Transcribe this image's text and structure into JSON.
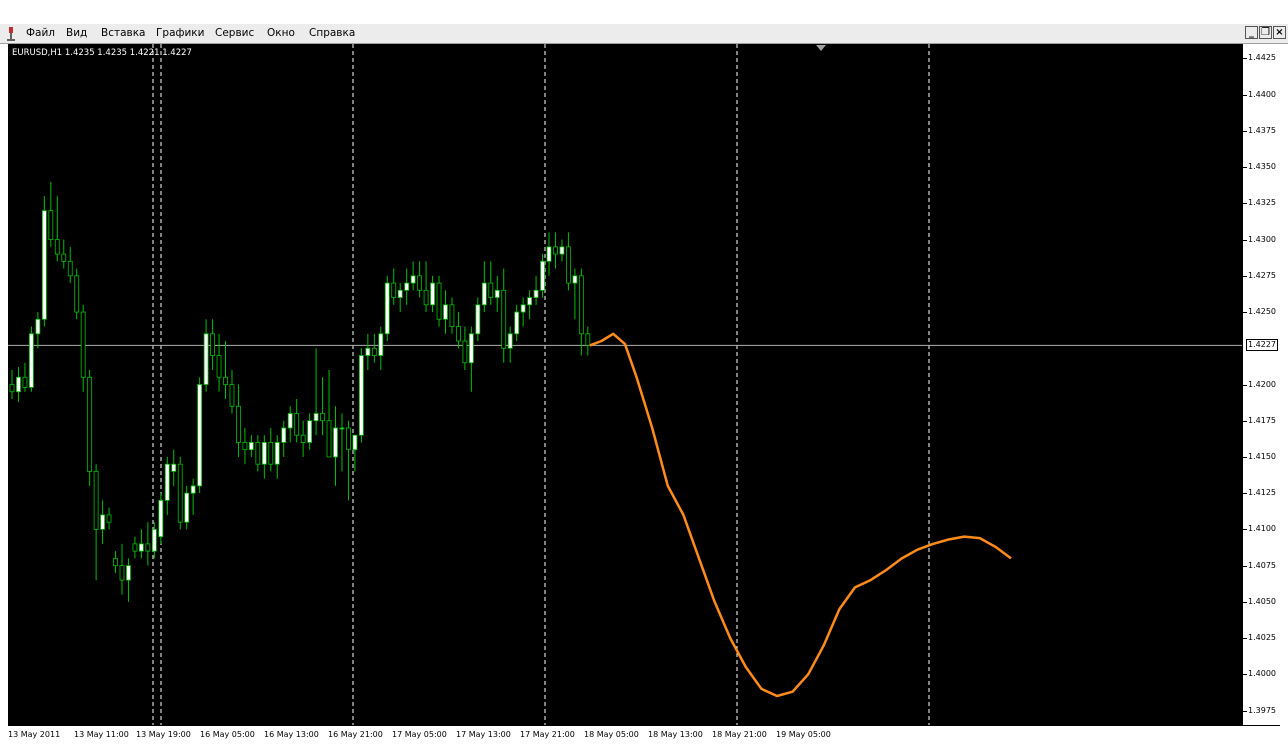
{
  "menu": {
    "items": [
      {
        "label": "Файл"
      },
      {
        "label": "Вид"
      },
      {
        "label": "Вставка"
      },
      {
        "label": "Графики"
      },
      {
        "label": "Сервис"
      },
      {
        "label": "Окно"
      },
      {
        "label": "Справка"
      }
    ]
  },
  "window_controls": {
    "minimize": "_",
    "restore": "❐",
    "close": "×"
  },
  "chart": {
    "symbol_info": "EURUSD,H1  1.4235 1.4235 1.4221 1.4227",
    "current_price": "1.4227",
    "colors": {
      "background": "#000000",
      "bull_candle": "#ffffff",
      "bear_candle": "#000000",
      "wick": "#00c000",
      "forecast_line": "#ff8c1a",
      "grid": "#ffffff"
    }
  },
  "chart_data": {
    "type": "candlestick",
    "symbol": "EURUSD",
    "timeframe": "H1",
    "ylim": [
      1.3965,
      1.4435
    ],
    "y_ticks": [
      "1.4425",
      "1.4400",
      "1.4375",
      "1.4350",
      "1.4325",
      "1.4300",
      "1.4275",
      "1.4250",
      "1.4200",
      "1.4175",
      "1.4150",
      "1.4125",
      "1.4100",
      "1.4075",
      "1.4050",
      "1.4025",
      "1.4000",
      "1.3975"
    ],
    "x_ticks": [
      "13 May 2011",
      "13 May 11:00",
      "13 May 19:00",
      "16 May 05:00",
      "16 May 13:00",
      "16 May 21:00",
      "17 May 05:00",
      "17 May 13:00",
      "17 May 21:00",
      "18 May 05:00",
      "18 May 13:00",
      "18 May 21:00",
      "19 May 05:00"
    ],
    "current_price": 1.4227,
    "ohlc": [
      [
        1.42,
        1.421,
        1.419,
        1.4195
      ],
      [
        1.4195,
        1.4212,
        1.4188,
        1.4205
      ],
      [
        1.4205,
        1.4215,
        1.4195,
        1.4198
      ],
      [
        1.4198,
        1.424,
        1.4195,
        1.4235
      ],
      [
        1.4235,
        1.425,
        1.4225,
        1.4245
      ],
      [
        1.4245,
        1.433,
        1.424,
        1.432
      ],
      [
        1.432,
        1.434,
        1.4295,
        1.43
      ],
      [
        1.43,
        1.433,
        1.4285,
        1.429
      ],
      [
        1.429,
        1.43,
        1.428,
        1.4285
      ],
      [
        1.4285,
        1.4295,
        1.427,
        1.4275
      ],
      [
        1.4275,
        1.428,
        1.4245,
        1.425
      ],
      [
        1.425,
        1.4255,
        1.4195,
        1.4205
      ],
      [
        1.4205,
        1.421,
        1.413,
        1.414
      ],
      [
        1.414,
        1.4145,
        1.4065,
        1.41
      ],
      [
        1.41,
        1.412,
        1.409,
        1.411
      ],
      [
        1.411,
        1.4115,
        1.41,
        1.4105
      ],
      [
        1.408,
        1.4085,
        1.407,
        1.4075
      ],
      [
        1.4075,
        1.409,
        1.4055,
        1.4065
      ],
      [
        1.4065,
        1.408,
        1.405,
        1.4075
      ],
      [
        1.409,
        1.4095,
        1.408,
        1.4085
      ],
      [
        1.4085,
        1.41,
        1.408,
        1.409
      ],
      [
        1.409,
        1.4105,
        1.4075,
        1.4085
      ],
      [
        1.4085,
        1.4105,
        1.408,
        1.41
      ],
      [
        1.4095,
        1.4125,
        1.409,
        1.412
      ],
      [
        1.412,
        1.415,
        1.411,
        1.4145
      ],
      [
        1.414,
        1.4155,
        1.413,
        1.4145
      ],
      [
        1.4145,
        1.415,
        1.41,
        1.4105
      ],
      [
        1.4105,
        1.413,
        1.41,
        1.4125
      ],
      [
        1.4125,
        1.4135,
        1.411,
        1.413
      ],
      [
        1.413,
        1.4205,
        1.4125,
        1.42
      ],
      [
        1.42,
        1.4245,
        1.4195,
        1.4235
      ],
      [
        1.4235,
        1.4245,
        1.421,
        1.422
      ],
      [
        1.422,
        1.4235,
        1.4195,
        1.4205
      ],
      [
        1.4205,
        1.423,
        1.419,
        1.42
      ],
      [
        1.42,
        1.421,
        1.418,
        1.4185
      ],
      [
        1.4185,
        1.42,
        1.415,
        1.416
      ],
      [
        1.416,
        1.417,
        1.4145,
        1.4155
      ],
      [
        1.4155,
        1.4165,
        1.415,
        1.416
      ],
      [
        1.416,
        1.4165,
        1.414,
        1.4145
      ],
      [
        1.4145,
        1.4165,
        1.4135,
        1.416
      ],
      [
        1.416,
        1.417,
        1.414,
        1.4145
      ],
      [
        1.4145,
        1.4165,
        1.4135,
        1.416
      ],
      [
        1.416,
        1.4175,
        1.415,
        1.417
      ],
      [
        1.417,
        1.4185,
        1.416,
        1.418
      ],
      [
        1.418,
        1.419,
        1.416,
        1.4165
      ],
      [
        1.4165,
        1.4175,
        1.415,
        1.416
      ],
      [
        1.416,
        1.418,
        1.4155,
        1.4175
      ],
      [
        1.4175,
        1.4225,
        1.4165,
        1.418
      ],
      [
        1.418,
        1.4205,
        1.4165,
        1.4175
      ],
      [
        1.4175,
        1.421,
        1.415,
        1.415
      ],
      [
        1.415,
        1.4185,
        1.413,
        1.417
      ],
      [
        1.417,
        1.418,
        1.414,
        1.417
      ],
      [
        1.417,
        1.4175,
        1.412,
        1.4155
      ],
      [
        1.4155,
        1.4165,
        1.414,
        1.4165
      ],
      [
        1.4165,
        1.4225,
        1.416,
        1.422
      ],
      [
        1.422,
        1.4235,
        1.421,
        1.4225
      ],
      [
        1.4225,
        1.4235,
        1.4215,
        1.422
      ],
      [
        1.422,
        1.424,
        1.421,
        1.4235
      ],
      [
        1.4235,
        1.4275,
        1.423,
        1.427
      ],
      [
        1.427,
        1.428,
        1.4255,
        1.426
      ],
      [
        1.426,
        1.427,
        1.425,
        1.4265
      ],
      [
        1.4265,
        1.428,
        1.4255,
        1.427
      ],
      [
        1.427,
        1.4285,
        1.4265,
        1.4275
      ],
      [
        1.4275,
        1.4285,
        1.426,
        1.4265
      ],
      [
        1.4265,
        1.4285,
        1.425,
        1.4255
      ],
      [
        1.4255,
        1.4275,
        1.425,
        1.427
      ],
      [
        1.427,
        1.4275,
        1.424,
        1.4245
      ],
      [
        1.4245,
        1.4265,
        1.4235,
        1.4255
      ],
      [
        1.4255,
        1.426,
        1.4235,
        1.424
      ],
      [
        1.424,
        1.425,
        1.4225,
        1.423
      ],
      [
        1.423,
        1.424,
        1.421,
        1.4215
      ],
      [
        1.4215,
        1.424,
        1.4195,
        1.4235
      ],
      [
        1.4235,
        1.426,
        1.423,
        1.4255
      ],
      [
        1.4255,
        1.4285,
        1.425,
        1.427
      ],
      [
        1.427,
        1.4285,
        1.4255,
        1.426
      ],
      [
        1.426,
        1.4275,
        1.425,
        1.4265
      ],
      [
        1.4265,
        1.428,
        1.4215,
        1.4225
      ],
      [
        1.4225,
        1.424,
        1.4215,
        1.4235
      ],
      [
        1.4235,
        1.4255,
        1.423,
        1.425
      ],
      [
        1.425,
        1.426,
        1.424,
        1.4255
      ],
      [
        1.4255,
        1.4265,
        1.4245,
        1.426
      ],
      [
        1.426,
        1.4275,
        1.4255,
        1.4265
      ],
      [
        1.4265,
        1.429,
        1.426,
        1.4285
      ],
      [
        1.4285,
        1.4305,
        1.4275,
        1.4295
      ],
      [
        1.4295,
        1.4305,
        1.428,
        1.429
      ],
      [
        1.429,
        1.43,
        1.4285,
        1.4295
      ],
      [
        1.4295,
        1.4305,
        1.4265,
        1.427
      ],
      [
        1.427,
        1.428,
        1.4245,
        1.4275
      ],
      [
        1.4275,
        1.428,
        1.422,
        1.4235
      ],
      [
        1.4235,
        1.424,
        1.422,
        1.4227
      ]
    ],
    "forecast": [
      [
        0,
        1.4227
      ],
      [
        3,
        1.423
      ],
      [
        6,
        1.4235
      ],
      [
        9,
        1.4228
      ],
      [
        12,
        1.4205
      ],
      [
        16,
        1.417
      ],
      [
        20,
        1.413
      ],
      [
        24,
        1.411
      ],
      [
        28,
        1.408
      ],
      [
        32,
        1.405
      ],
      [
        36,
        1.4025
      ],
      [
        40,
        1.4005
      ],
      [
        44,
        1.399
      ],
      [
        48,
        1.3985
      ],
      [
        52,
        1.3988
      ],
      [
        56,
        1.4
      ],
      [
        60,
        1.402
      ],
      [
        64,
        1.4045
      ],
      [
        68,
        1.406
      ],
      [
        72,
        1.4065
      ],
      [
        76,
        1.4072
      ],
      [
        80,
        1.408
      ],
      [
        84,
        1.4086
      ],
      [
        88,
        1.409
      ],
      [
        92,
        1.4093
      ],
      [
        96,
        1.4095
      ],
      [
        100,
        1.4094
      ],
      [
        104,
        1.4088
      ],
      [
        108,
        1.408
      ]
    ]
  }
}
